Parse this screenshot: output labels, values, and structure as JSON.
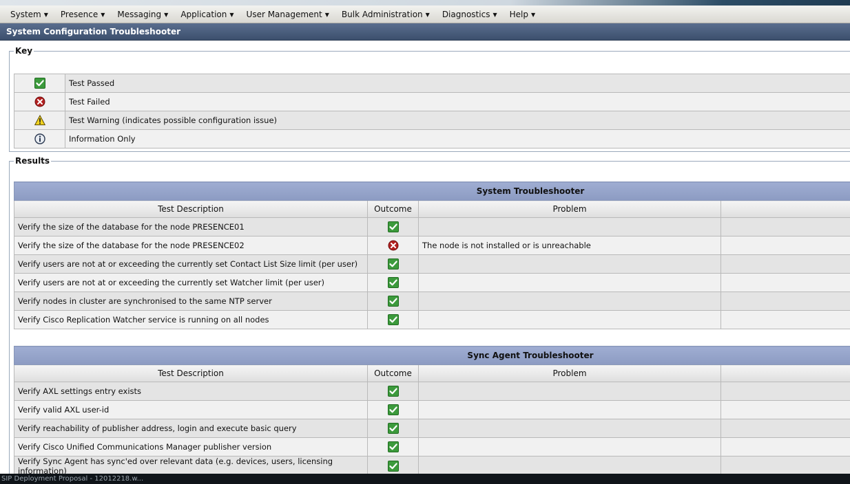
{
  "menu": [
    {
      "label": "System"
    },
    {
      "label": "Presence"
    },
    {
      "label": "Messaging"
    },
    {
      "label": "Application"
    },
    {
      "label": "User Management"
    },
    {
      "label": "Bulk Administration"
    },
    {
      "label": "Diagnostics"
    },
    {
      "label": "Help"
    }
  ],
  "page_title": "System Configuration Troubleshooter",
  "key": {
    "legend": "Key",
    "items": [
      {
        "icon": "check-icon",
        "label": "Test Passed"
      },
      {
        "icon": "error-icon",
        "label": "Test Failed"
      },
      {
        "icon": "warning-icon",
        "label": "Test Warning (indicates possible configuration issue)"
      },
      {
        "icon": "info-icon",
        "label": "Information Only"
      }
    ]
  },
  "results": {
    "legend": "Results",
    "sections": [
      {
        "title": "System Troubleshooter",
        "headers": {
          "description": "Test Description",
          "outcome": "Outcome",
          "problem": "Problem"
        },
        "rows": [
          {
            "description": "Verify the size of the database for the node PRESENCE01",
            "outcome": "pass",
            "problem": ""
          },
          {
            "description": "Verify the size of the database for the node PRESENCE02",
            "outcome": "fail",
            "problem": "The node is not installed or is unreachable"
          },
          {
            "description": "Verify users are not at or exceeding the currently set Contact List Size limit (per user)",
            "outcome": "pass",
            "problem": ""
          },
          {
            "description": "Verify users are not at or exceeding the currently set Watcher limit (per user)",
            "outcome": "pass",
            "problem": ""
          },
          {
            "description": "Verify nodes in cluster are synchronised to the same NTP server",
            "outcome": "pass",
            "problem": ""
          },
          {
            "description": "Verify Cisco Replication Watcher service is running on all nodes",
            "outcome": "pass",
            "problem": ""
          }
        ]
      },
      {
        "title": "Sync Agent Troubleshooter",
        "headers": {
          "description": "Test Description",
          "outcome": "Outcome",
          "problem": "Problem"
        },
        "rows": [
          {
            "description": "Verify AXL settings entry exists",
            "outcome": "pass",
            "problem": ""
          },
          {
            "description": "Verify valid AXL user-id",
            "outcome": "pass",
            "problem": ""
          },
          {
            "description": "Verify reachability of publisher address, login and execute basic query",
            "outcome": "pass",
            "problem": ""
          },
          {
            "description": "Verify Cisco Unified Communications Manager publisher version",
            "outcome": "pass",
            "problem": ""
          },
          {
            "description": "Verify Sync Agent has sync'ed over relevant data (e.g. devices, users, licensing information)",
            "outcome": "pass",
            "problem": ""
          }
        ]
      }
    ]
  },
  "taskbar": {
    "text": "SIP Deployment Proposal - 12012218.w..."
  }
}
